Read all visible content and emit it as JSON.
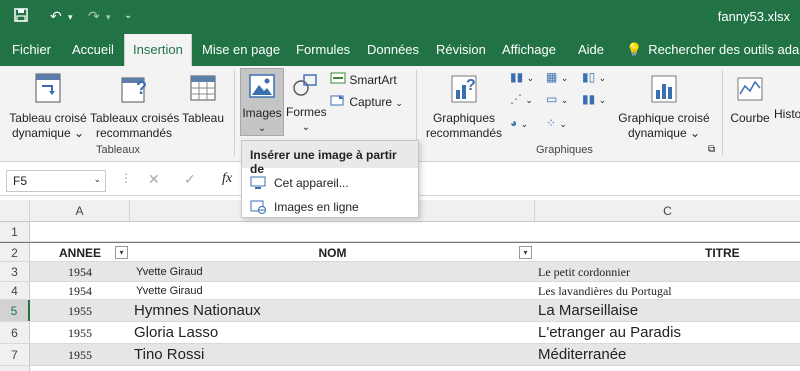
{
  "titlebar": {
    "filename": "fanny53.xlsx"
  },
  "tabs": {
    "fichier": "Fichier",
    "accueil": "Accueil",
    "insertion": "Insertion",
    "mise_en_page": "Mise en page",
    "formules": "Formules",
    "donnees": "Données",
    "revision": "Révision",
    "affichage": "Affichage",
    "aide": "Aide",
    "search": "Rechercher des outils adap"
  },
  "ribbon": {
    "tableau_croise_1": "Tableau croisé",
    "tableau_croise_2": "dynamique",
    "tableaux_recommandes_1": "Tableaux croisés",
    "tableaux_recommandes_2": "recommandés",
    "tableau": "Tableau",
    "group_tableaux": "Tableaux",
    "images": "Images",
    "formes": "Formes",
    "smartart": "SmartArt",
    "capture": "Capture",
    "graphiques_rec_1": "Graphiques",
    "graphiques_rec_2": "recommandés",
    "graphique_croise_1": "Graphique croisé",
    "graphique_croise_2": "dynamique",
    "group_graphiques": "Graphiques",
    "courbe": "Courbe",
    "histo": "Histo"
  },
  "dropdown": {
    "header": "Insérer une image à partir de",
    "item1": "Cet appareil...",
    "item2": "Images en ligne"
  },
  "formula": {
    "cell_ref": "F5",
    "fx": "fx"
  },
  "columns": {
    "a": "A",
    "c": "C"
  },
  "table": {
    "headers": {
      "annee": "ANNEE",
      "nom": "NOM",
      "titre": "TITRE"
    },
    "rows": [
      {
        "num": "1",
        "annee": "",
        "nom": "",
        "titre": ""
      },
      {
        "num": "2",
        "annee": "ANNEE",
        "nom": "NOM",
        "titre": "TITRE"
      },
      {
        "num": "3",
        "annee": "1954",
        "nom": "Yvette Giraud",
        "titre": "Le petit cordonnier"
      },
      {
        "num": "4",
        "annee": "1954",
        "nom": "Yvette Giraud",
        "titre": "Les lavandières du Portugal"
      },
      {
        "num": "5",
        "annee": "1955",
        "nom": "Hymnes Nationaux",
        "titre": "La Marseillaise"
      },
      {
        "num": "6",
        "annee": "1955",
        "nom": "Gloria Lasso",
        "titre": "L'etranger au Paradis"
      },
      {
        "num": "7",
        "annee": "1955",
        "nom": "Tino Rossi",
        "titre": "Méditerranée"
      }
    ]
  },
  "colors": {
    "excel_green": "#217346",
    "band": "#e6e6e6"
  }
}
